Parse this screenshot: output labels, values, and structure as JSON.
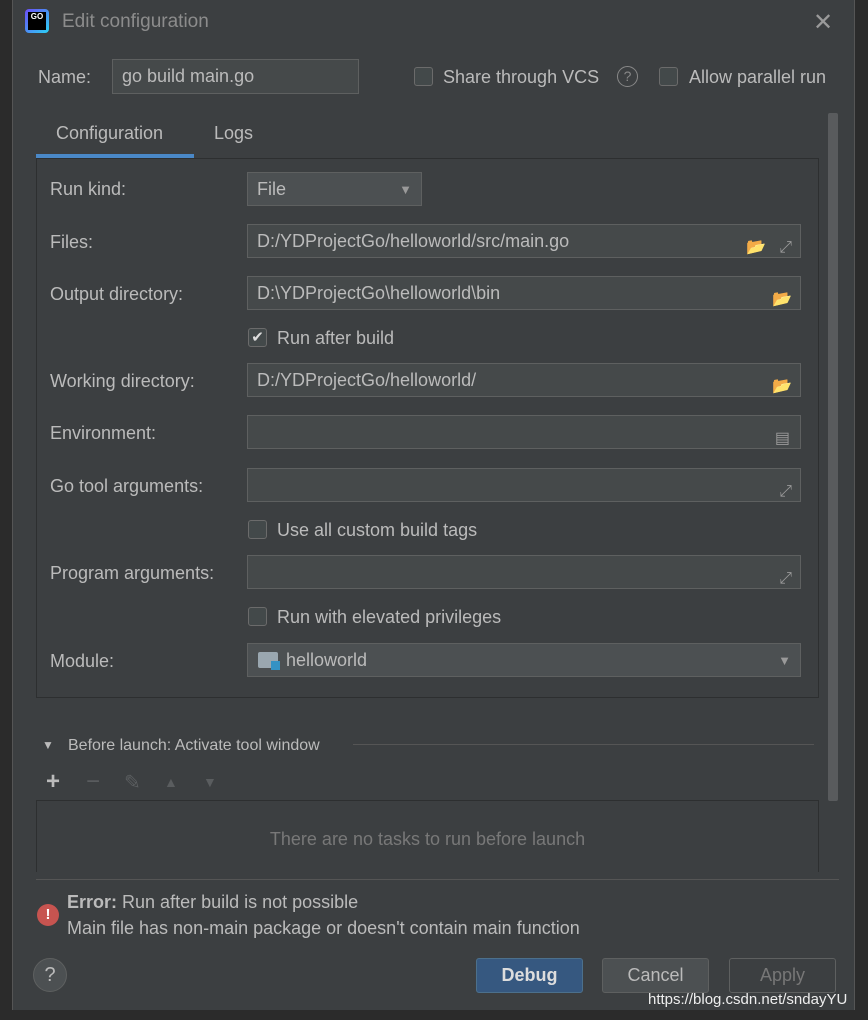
{
  "title": "Edit configuration",
  "name_label": "Name:",
  "name_value": "go build main.go",
  "share_vcs": {
    "label": "Share through VCS",
    "checked": false
  },
  "allow_parallel": {
    "label": "Allow parallel run",
    "checked": false
  },
  "tabs": [
    {
      "label": "Configuration",
      "active": true
    },
    {
      "label": "Logs",
      "active": false
    }
  ],
  "form": {
    "run_kind": {
      "label": "Run kind:",
      "value": "File"
    },
    "files": {
      "label": "Files:",
      "value": "D:/YDProjectGo/helloworld/src/main.go"
    },
    "output_dir": {
      "label": "Output directory:",
      "value": "D:\\YDProjectGo\\helloworld\\bin"
    },
    "run_after_build": {
      "label": "Run after build",
      "checked": true
    },
    "working_dir": {
      "label": "Working directory:",
      "value": "D:/YDProjectGo/helloworld/"
    },
    "environment": {
      "label": "Environment:",
      "value": ""
    },
    "go_tool_args": {
      "label": "Go tool arguments:",
      "value": ""
    },
    "use_custom_tags": {
      "label": "Use all custom build tags",
      "checked": false
    },
    "program_args": {
      "label": "Program arguments:",
      "value": ""
    },
    "elevated": {
      "label": "Run with elevated privileges",
      "checked": false
    },
    "module": {
      "label": "Module:",
      "value": "helloworld"
    }
  },
  "before_launch": {
    "title": "Before launch: Activate tool window",
    "empty": "There are no tasks to run before launch"
  },
  "error": {
    "prefix": "Error:",
    "message": "Run after build is not possible",
    "detail": "Main file has non-main package or doesn't contain main function"
  },
  "buttons": {
    "debug": "Debug",
    "cancel": "Cancel",
    "apply": "Apply",
    "help": "?"
  },
  "watermark": "https://blog.csdn.net/sndayYU",
  "colors": {
    "accent": "#4a88c7",
    "primary_button": "#365880",
    "error": "#c75450"
  }
}
